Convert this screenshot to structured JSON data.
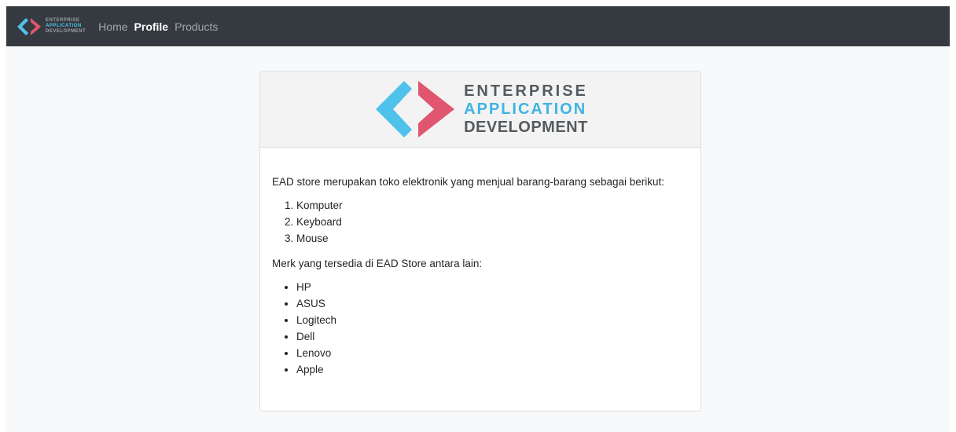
{
  "navbar": {
    "brand": {
      "line1": "ENTERPRISE",
      "line2": "APPLICATION",
      "line3": "DEVELOPMENT"
    },
    "links": [
      {
        "label": "Home",
        "active": false
      },
      {
        "label": "Profile",
        "active": true
      },
      {
        "label": "Products",
        "active": false
      }
    ]
  },
  "card": {
    "logo": {
      "line1": "ENTERPRISE",
      "line2": "APPLICATION",
      "line3": "DEVELOPMENT"
    },
    "intro": "EAD store merupakan toko elektronik yang menjual barang-barang sebagai berikut:",
    "products": [
      "Komputer",
      "Keyboard",
      "Mouse"
    ],
    "brands_intro": "Merk yang tersedia di EAD Store antara lain:",
    "brands": [
      "HP",
      "ASUS",
      "Logitech",
      "Dell",
      "Lenovo",
      "Apple"
    ]
  },
  "colors": {
    "navbar_bg": "#343a40",
    "logo_blue": "#4ec2ea",
    "logo_red": "#e0566e",
    "logo_gray": "#555a5f"
  }
}
